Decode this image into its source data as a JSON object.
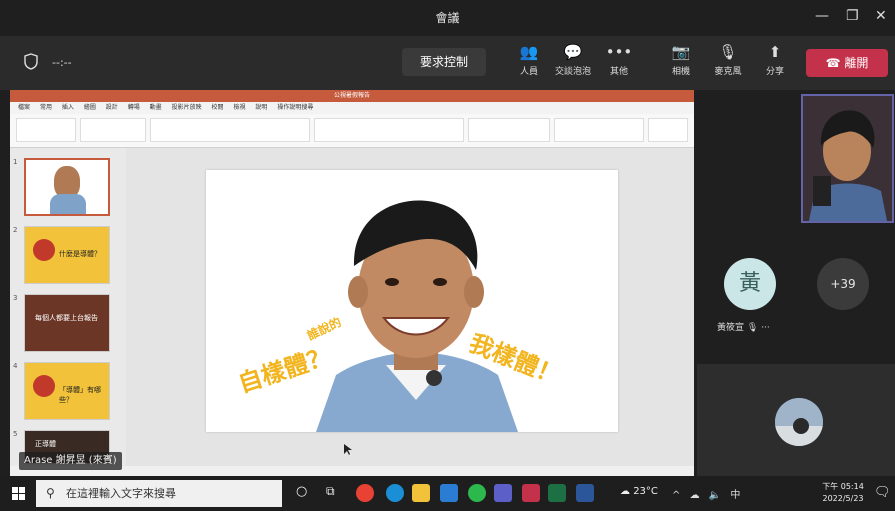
{
  "window": {
    "title": "會議",
    "controls": [
      "—",
      "❐",
      "✕"
    ]
  },
  "toolbar": {
    "timer": "--:--",
    "request_control": "要求控制",
    "buttons": [
      {
        "label": "人員",
        "icon": "people-icon"
      },
      {
        "label": "交談泡泡",
        "icon": "chat-icon"
      },
      {
        "label": "其他",
        "icon": "more-icon"
      },
      {
        "label": "相機",
        "icon": "camera-off-icon"
      },
      {
        "label": "麥克風",
        "icon": "mic-off-icon"
      },
      {
        "label": "分享",
        "icon": "share-icon"
      }
    ],
    "leave": "離開",
    "leave_color": "#c4314b"
  },
  "presentation": {
    "title": "公視暑假報告",
    "menu": [
      "檔案",
      "常用",
      "插入",
      "繪圖",
      "設計",
      "轉場",
      "動畫",
      "投影片放映",
      "校閱",
      "檢視",
      "說明",
      "操作說明搜尋"
    ],
    "slides": [
      {
        "number": "1",
        "bg": "#ffffff"
      },
      {
        "number": "2",
        "text": "什麼是導體？",
        "bg": "#f2c23a"
      },
      {
        "number": "3",
        "text": "每個人都要上台報告",
        "bg": "#6b3626"
      },
      {
        "number": "4",
        "text": "「導體」有哪些？",
        "bg": "#f2c23a"
      },
      {
        "number": "5",
        "text": "正導體",
        "bg": "#3a2a24"
      }
    ],
    "slide_text": {
      "left_small": "誰說的",
      "left_big": "自樣體？",
      "right_big": "我樣體！"
    },
    "accent": "#f2b51f"
  },
  "presenter_tag": "Arase 謝昇昱 (來賓)",
  "participants": {
    "p1_initial": "黃",
    "p1_name": "黃筱宣",
    "more_count": "+39"
  },
  "taskbar": {
    "search_placeholder": "在這裡輸入文字來搜尋",
    "weather": "23°C",
    "time": "下午 05:14",
    "date": "2022/5/23",
    "ime": "中"
  }
}
